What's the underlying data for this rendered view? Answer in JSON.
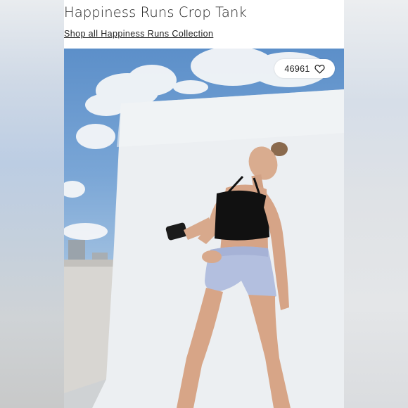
{
  "product": {
    "title": "Happiness Runs Crop Tank",
    "collection_link": "Shop all Happiness Runs Collection"
  },
  "likes": {
    "count": "46961",
    "icon": "heart-icon"
  },
  "photo": {
    "subject": "product-photo"
  }
}
